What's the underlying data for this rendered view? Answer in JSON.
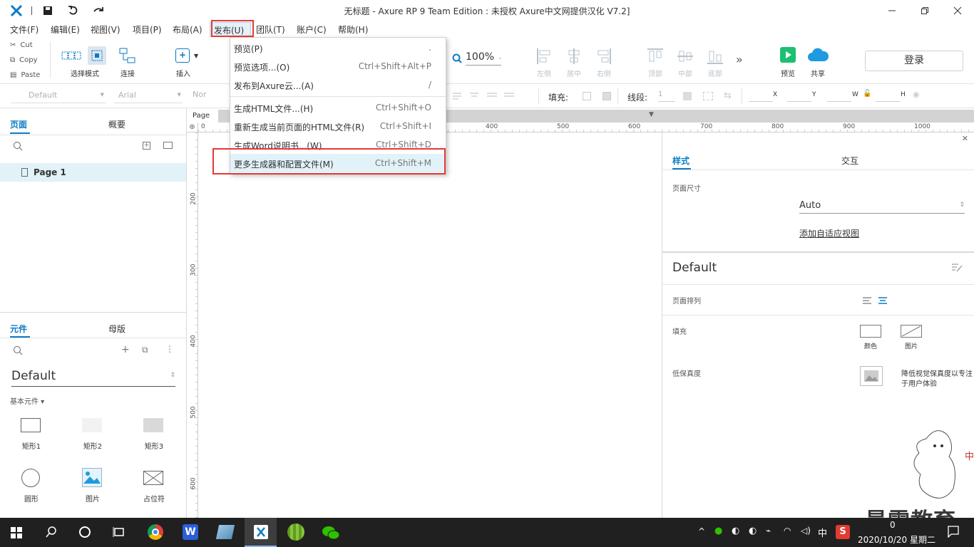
{
  "titlebar": {
    "title": "无标题 - Axure RP 9 Team Edition : 未授权    Axure中文网提供汉化 V7.2]"
  },
  "menubar": {
    "items": [
      "文件(F)",
      "编辑(E)",
      "视图(V)",
      "项目(P)",
      "布局(A)",
      "发布(U)",
      "团队(T)",
      "账户(C)",
      "帮助(H)"
    ]
  },
  "toolbar": {
    "clipboard": [
      "Cut",
      "Copy",
      "Paste"
    ],
    "select_mode": "选择模式",
    "connect": "连接",
    "insert": "插入",
    "zoom": "100%",
    "align": [
      "左侧",
      "居中",
      "右侧",
      "顶部",
      "中部",
      "底部"
    ],
    "preview": "预览",
    "share": "共享",
    "login": "登录"
  },
  "formatbar": {
    "style_default": "Default",
    "font": "Arial",
    "font_style": "Nor",
    "fill_label": "填充:",
    "line_label": "线段:",
    "line_value": "1",
    "x": "X",
    "y": "Y",
    "w": "W",
    "h": "H"
  },
  "pages_panel": {
    "tab_pages": "页面",
    "tab_outline": "概要",
    "page1": "Page 1"
  },
  "widgets_panel": {
    "tab_widgets": "元件",
    "tab_masters": "母版",
    "library": "Default",
    "section": "基本元件 ▾",
    "items": [
      "矩形1",
      "矩形2",
      "矩形3",
      "圆形",
      "图片",
      "占位符"
    ]
  },
  "canvas": {
    "page_tab": "Page",
    "ruler_h": [
      "0",
      "400",
      "500",
      "600",
      "700",
      "800",
      "900",
      "1000"
    ],
    "ruler_v": [
      "200",
      "300",
      "400",
      "500",
      "600"
    ]
  },
  "publish_menu": {
    "items": [
      {
        "label": "预览(P)",
        "shortcut": "."
      },
      {
        "label": "预览选项...(O)",
        "shortcut": "Ctrl+Shift+Alt+P"
      },
      {
        "label": "发布到Axure云...(A)",
        "shortcut": "/"
      },
      {
        "label": "生成HTML文件...(H)",
        "shortcut": "Ctrl+Shift+O"
      },
      {
        "label": "重新生成当前页面的HTML文件(R)",
        "shortcut": "Ctrl+Shift+I"
      },
      {
        "label": "生成Word说明书...(W)",
        "shortcut": "Ctrl+Shift+D"
      },
      {
        "label": "更多生成器和配置文件(M)",
        "shortcut": "Ctrl+Shift+M"
      }
    ]
  },
  "right_panel": {
    "tab_style": "样式",
    "tab_interaction": "交互",
    "page_size_label": "页面尺寸",
    "page_size_value": "Auto",
    "adaptive_link": "添加自适应视图",
    "style_name": "Default",
    "page_align_label": "页面排列",
    "fill_label": "填充",
    "fill_color": "颜色",
    "fill_image": "图片",
    "low_fidelity_label": "低保真度",
    "low_fidelity_desc_1": "降低视觉保真度以专注",
    "low_fidelity_desc_2": "于用户体验"
  },
  "watermark": {
    "text": "最需教育",
    "side": "中"
  },
  "taskbar": {
    "time": "0",
    "date": "2020/10/20 星期二",
    "ime": "中"
  },
  "colors": {
    "accent": "#0a7bc4",
    "highlight_red": "#e53935",
    "preview_green": "#1dbf73",
    "taskbar": "#202020"
  }
}
